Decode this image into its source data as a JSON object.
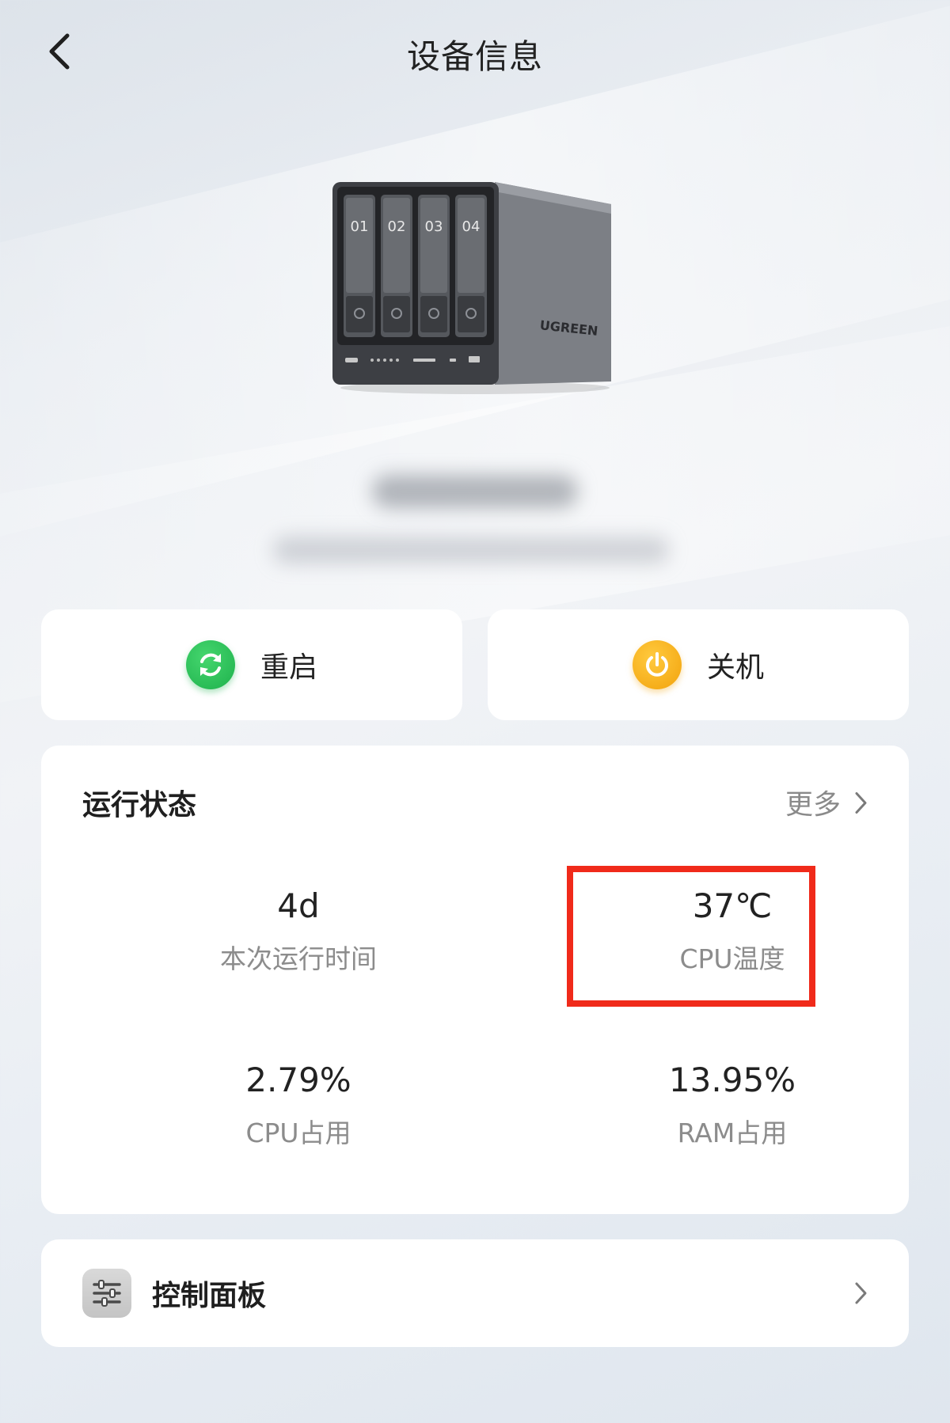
{
  "header": {
    "title": "设备信息",
    "back_icon": "chevron-left-icon"
  },
  "device": {
    "brand": "UGREEN",
    "bays": [
      "01",
      "02",
      "03",
      "04"
    ]
  },
  "actions": {
    "restart_label": "重启",
    "restart_icon": "refresh-icon",
    "shutdown_label": "关机",
    "shutdown_icon": "power-icon"
  },
  "status": {
    "title": "运行状态",
    "more_label": "更多",
    "more_icon": "chevron-right-icon",
    "uptime": {
      "value": "4d",
      "label": "本次运行时间"
    },
    "cpu_temp": {
      "value": "37℃",
      "label": "CPU温度"
    },
    "cpu_usage": {
      "value": "2.79%",
      "label": "CPU占用"
    },
    "ram_usage": {
      "value": "13.95%",
      "label": "RAM占用"
    }
  },
  "control_panel": {
    "label": "控制面板",
    "icon": "sliders-icon",
    "chevron_icon": "chevron-right-icon"
  },
  "colors": {
    "restart_green": "#1eb14c",
    "shutdown_orange": "#f2a20c",
    "highlight_red": "#f02a1a"
  }
}
